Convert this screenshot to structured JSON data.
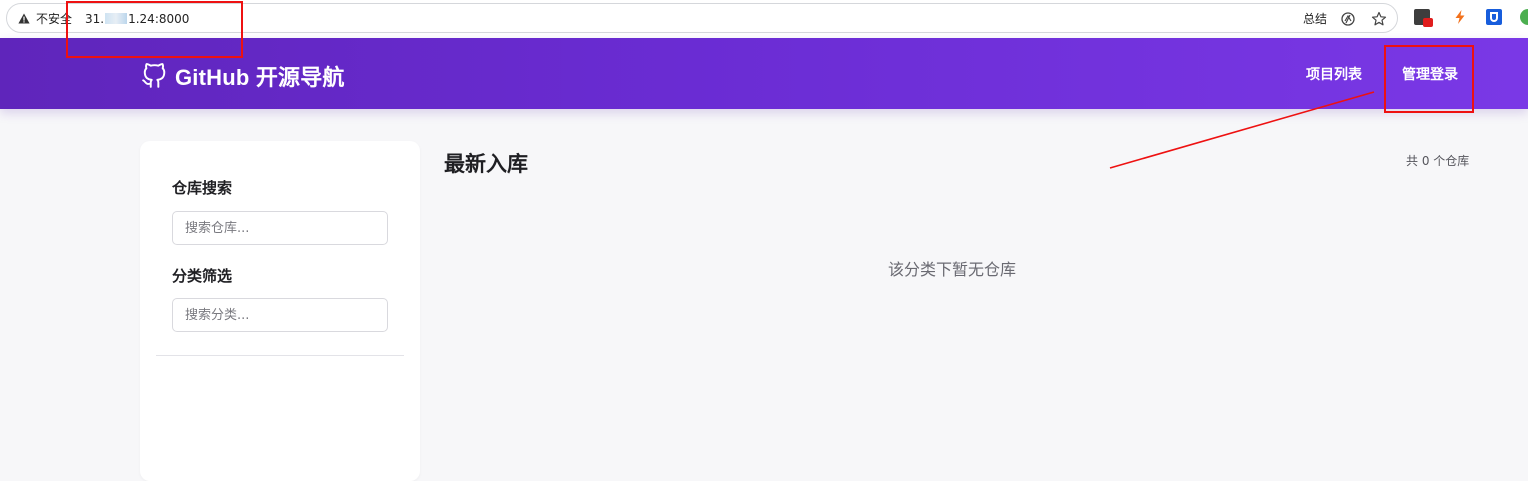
{
  "browser": {
    "security_label": "不安全",
    "url_prefix": "31.",
    "url_suffix": "1.24:8000",
    "summary_label": "总结",
    "icons": [
      "warning-icon",
      "translate-icon",
      "star-icon",
      "extension-icon",
      "bolt-icon",
      "bitwarden-icon",
      "profile-icon"
    ]
  },
  "header": {
    "brand": "GitHub 开源导航",
    "nav": {
      "projects": "项目列表",
      "admin_login": "管理登录"
    }
  },
  "sidebar": {
    "search_title": "仓库搜索",
    "search_placeholder": "搜索仓库...",
    "filter_title": "分类筛选",
    "filter_placeholder": "搜索分类..."
  },
  "main": {
    "title": "最新入库",
    "count": "共 0 个仓库",
    "empty_message": "该分类下暂无仓库"
  },
  "colors": {
    "header_gradient_start": "#5f25bb",
    "header_gradient_end": "#7a38e6",
    "annotation": "#ee1111",
    "page_bg": "#f7f7f9"
  }
}
